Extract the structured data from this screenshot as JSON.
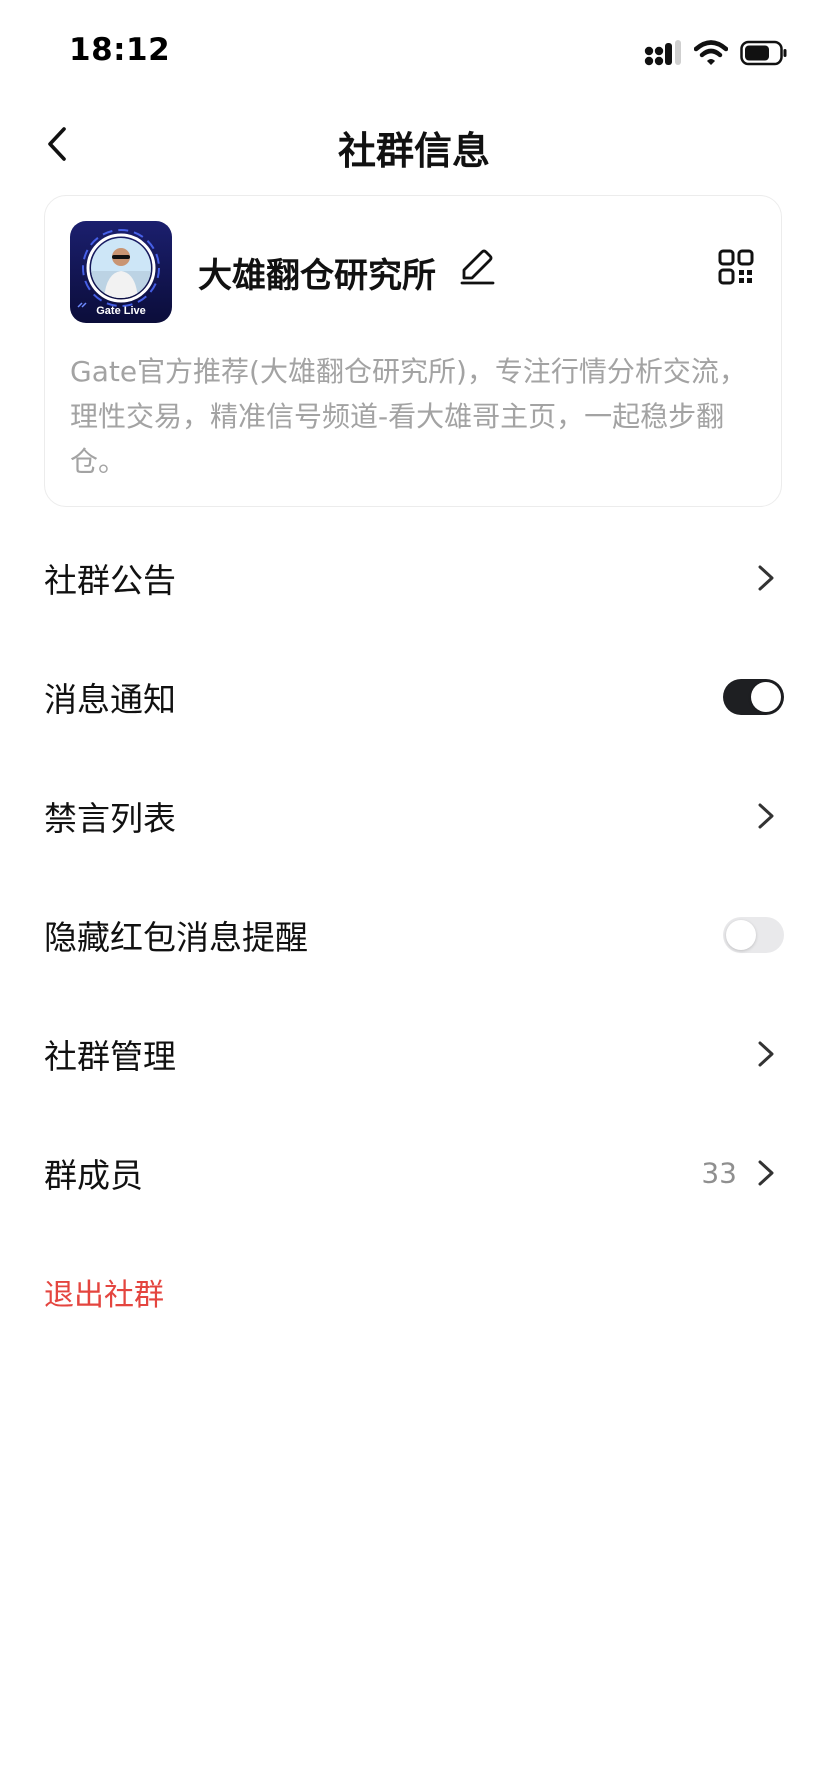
{
  "status_bar": {
    "time": "18:12"
  },
  "nav": {
    "title": "社群信息"
  },
  "group": {
    "name": "大雄翻仓研究所",
    "avatar_caption": "Gate Live",
    "description": "Gate官方推荐(大雄翻仓研究所)，专注行情分析交流，理性交易，精准信号频道-看大雄哥主页，一起稳步翻仓。"
  },
  "settings": {
    "announcement_label": "社群公告",
    "notification_label": "消息通知",
    "notification_on": true,
    "mute_list_label": "禁言列表",
    "hide_red_packet_label": "隐藏红包消息提醒",
    "hide_red_packet_on": false,
    "management_label": "社群管理",
    "members_label": "群成员",
    "members_count": "33"
  },
  "actions": {
    "exit_label": "退出社群"
  },
  "colors": {
    "accent_danger": "#e4453f",
    "toggle_on": "#1e1f22",
    "toggle_off": "#e9e9eb",
    "muted_text": "#a3a3a3"
  },
  "icons": {
    "back": "chevron-left-icon",
    "edit": "pencil-icon",
    "qr": "qr-code-icon",
    "chevron": "chevron-right-icon",
    "signal": "signal-icon",
    "wifi": "wifi-icon",
    "battery": "battery-icon"
  }
}
